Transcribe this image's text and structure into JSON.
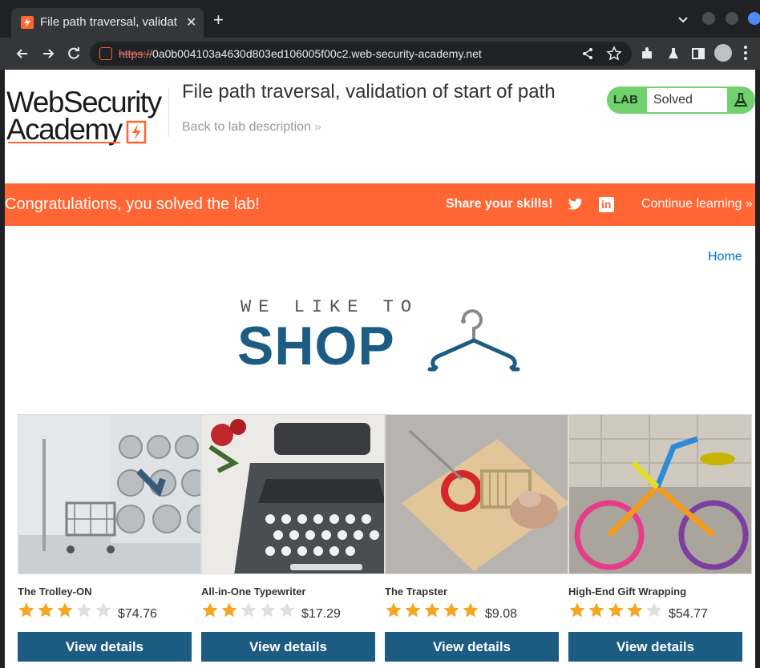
{
  "browser": {
    "tab_title": "File path traversal, validat",
    "url_scheme": "https://",
    "url_host": "0a0b004103a4630d803ed106005f00c2.web-security-academy.net"
  },
  "header": {
    "logo_line1": "WebSecurity",
    "logo_line2": "Academy",
    "lab_title": "File path traversal, validation of start of path",
    "back_link": "Back to lab description",
    "back_chevron": "»",
    "lab_badge": "LAB",
    "lab_status": "Solved"
  },
  "banner": {
    "congrats": "Congratulations, you solved the lab!",
    "share_label": "Share your skills!",
    "continue_label": "Continue learning",
    "continue_chevron": "»"
  },
  "nav": {
    "home": "Home"
  },
  "shop_logo": {
    "tagline": "WE LIKE TO",
    "word": "SHOP"
  },
  "products": [
    {
      "name": "The Trolley-ON",
      "rating": 3,
      "price": "$74.76",
      "button": "View details"
    },
    {
      "name": "All-in-One Typewriter",
      "rating": 2,
      "price": "$17.29",
      "button": "View details"
    },
    {
      "name": "The Trapster",
      "rating": 5,
      "price": "$9.08",
      "button": "View details"
    },
    {
      "name": "High-End Gift Wrapping",
      "rating": 4,
      "price": "$54.77",
      "button": "View details"
    }
  ],
  "colors": {
    "accent": "#ff6633",
    "primary": "#1c5c82",
    "lab_green": "#70d16d",
    "star_on": "#f5a623",
    "star_off": "#e0e0e0"
  }
}
